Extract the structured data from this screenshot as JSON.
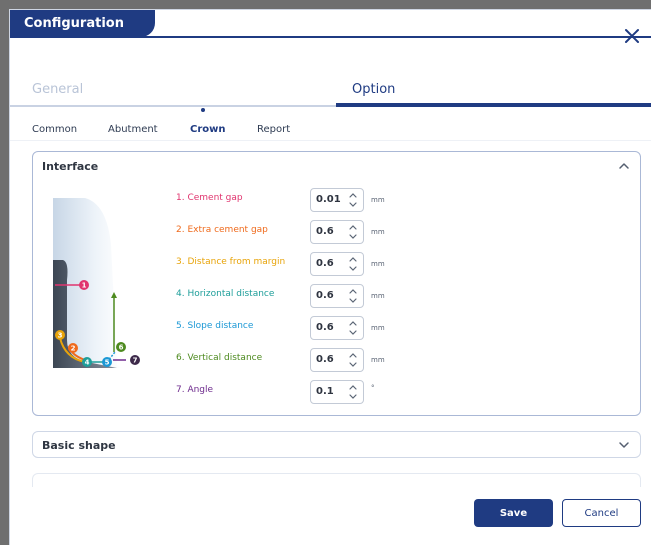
{
  "window": {
    "title": "Configuration"
  },
  "tabs": {
    "general": "General",
    "option": "Option"
  },
  "sub_tabs": [
    "Common",
    "Abutment",
    "Crown",
    "Report"
  ],
  "interface": {
    "title": "Interface",
    "params": [
      {
        "label": "1. Cement gap",
        "value": "0.01",
        "unit": "mm",
        "color": "#e0356f"
      },
      {
        "label": "2. Extra cement gap",
        "value": "0.6",
        "unit": "mm",
        "color": "#ef6a1c"
      },
      {
        "label": "3. Distance from margin",
        "value": "0.6",
        "unit": "mm",
        "color": "#e8a40a"
      },
      {
        "label": "4. Horizontal distance",
        "value": "0.6",
        "unit": "mm",
        "color": "#1e9e9a"
      },
      {
        "label": "5. Slope distance",
        "value": "0.6",
        "unit": "mm",
        "color": "#1b98d5"
      },
      {
        "label": "6. Vertical distance",
        "value": "0.6",
        "unit": "mm",
        "color": "#4d8a1f"
      },
      {
        "label": "7. Angle",
        "value": "0.1",
        "unit": "°",
        "color": "#6e2b8d"
      }
    ],
    "markers": [
      "1",
      "2",
      "3",
      "4",
      "5",
      "6",
      "7"
    ]
  },
  "basic_shape": {
    "title": "Basic shape"
  },
  "buttons": {
    "save": "Save",
    "cancel": "Cancel"
  },
  "colors": {
    "accent": "#1f3b82"
  }
}
